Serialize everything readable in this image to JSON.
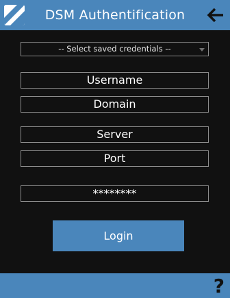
{
  "header": {
    "title": "DSM Authentification",
    "logo_icon": "app-logo-icon",
    "back_icon": "arrow-left-icon"
  },
  "form": {
    "credentials_select": "-- Select saved credentials --",
    "username_placeholder": "Username",
    "domain_placeholder": "Domain",
    "server_placeholder": "Server",
    "port_placeholder": "Port",
    "password_value": "********",
    "login_label": "Login"
  },
  "footer": {
    "help_label": "?",
    "help_icon": "question-mark-icon"
  },
  "colors": {
    "accent": "#4a86bb",
    "background": "#111111",
    "field_border": "#8c8c8c"
  }
}
